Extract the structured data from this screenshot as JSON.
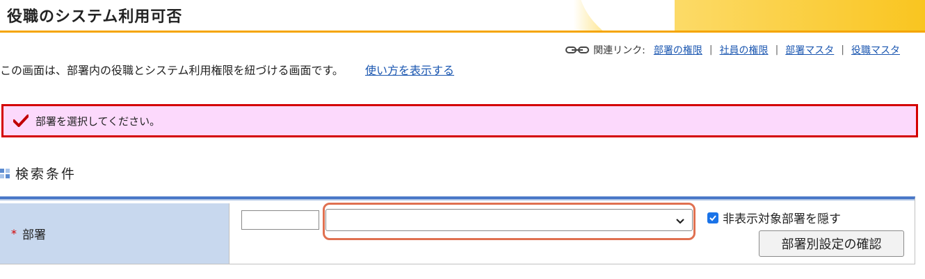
{
  "header": {
    "title": "役職のシステム利用可否"
  },
  "related_links": {
    "prefix": "関連リンク:",
    "separator": "|",
    "items": [
      "部署の権限",
      "社員の権限",
      "部署マスタ",
      "役職マスタ"
    ]
  },
  "description": {
    "text": "この画面は、部署内の役職とシステム利用権限を紐づける画面です。",
    "help_link": "使い方を表示する"
  },
  "alert": {
    "message": "部署を選択してください。"
  },
  "search": {
    "section_title": "検索条件",
    "department": {
      "required_mark": "*",
      "label": "部署",
      "code_value": "",
      "select_value": "",
      "hide_checkbox_label": "非表示対象部署を隠す",
      "hide_checkbox_checked": true,
      "confirm_button": "部署別設定の確認"
    }
  },
  "colors": {
    "accent_orange": "#f5a500",
    "link_blue": "#1a56b0",
    "alert_bg": "#fcd9fc",
    "alert_border": "#d40000",
    "form_accent": "#4a78c8",
    "label_bg": "#c8d8ee",
    "highlight": "#e07050"
  },
  "icons": {
    "related": "chain-link-icon",
    "alert": "check-mark-icon",
    "section": "grid-squares-icon",
    "select": "chevron-down-icon"
  }
}
